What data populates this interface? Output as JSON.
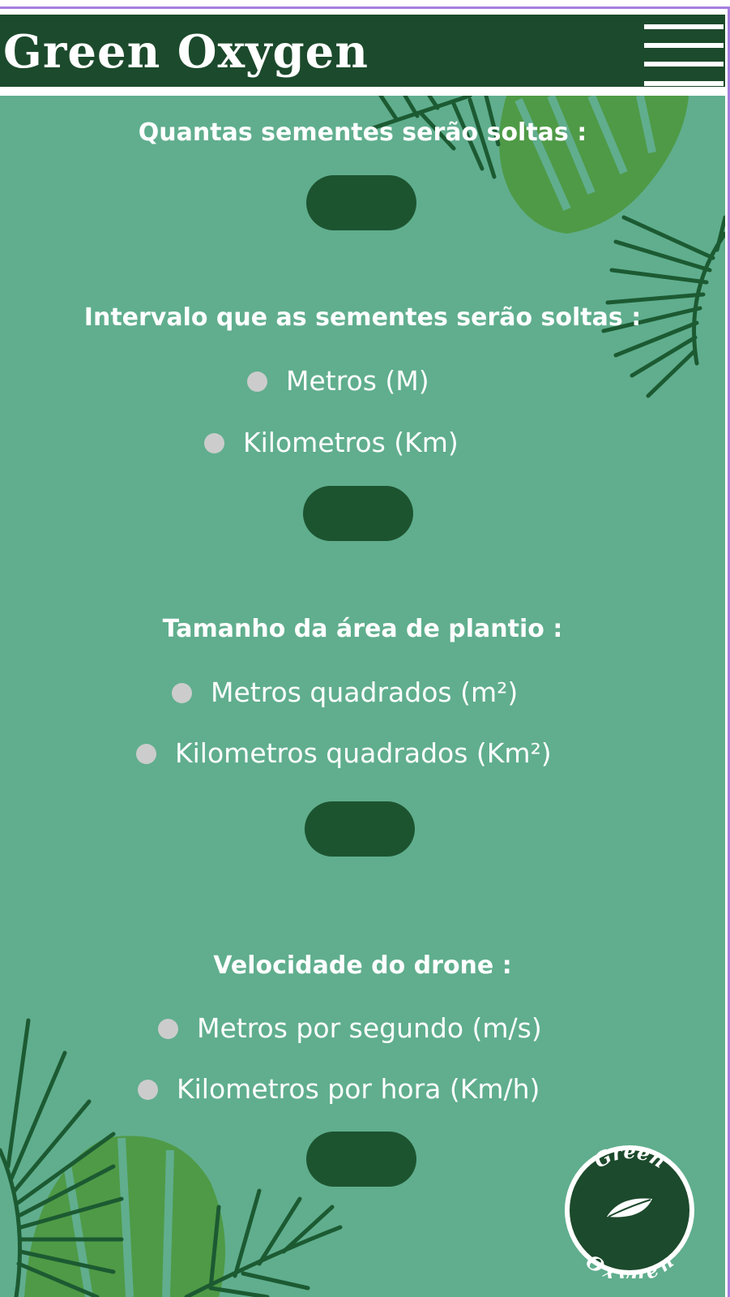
{
  "header": {
    "title": "Green Oxygen",
    "menu_icon": "hamburger-menu-icon"
  },
  "sections": [
    {
      "question": "Quantas sementes serão soltas :",
      "options": []
    },
    {
      "question": "Intervalo que as sementes serão soltas :",
      "options": [
        "Metros (M)",
        "Kilometros (Km)"
      ]
    },
    {
      "question": "Tamanho da área de plantio :",
      "options": [
        "Metros quadrados (m²)",
        "Kilometros quadrados (Km²)"
      ]
    },
    {
      "question": "Velocidade do drone :",
      "options": [
        "Metros por segundo (m/s)",
        "Kilometros por hora (Km/h)"
      ]
    }
  ],
  "logo": {
    "top_word": "Green",
    "bottom_word": "Oxygen",
    "icon": "leaf-icon"
  },
  "colors": {
    "header_bg": "#1c4a2c",
    "content_bg": "#60ae8e",
    "pill": "#1d5430",
    "radio": "#cccccc",
    "text": "#ffffff",
    "frame_accent": "#a77ee0"
  }
}
